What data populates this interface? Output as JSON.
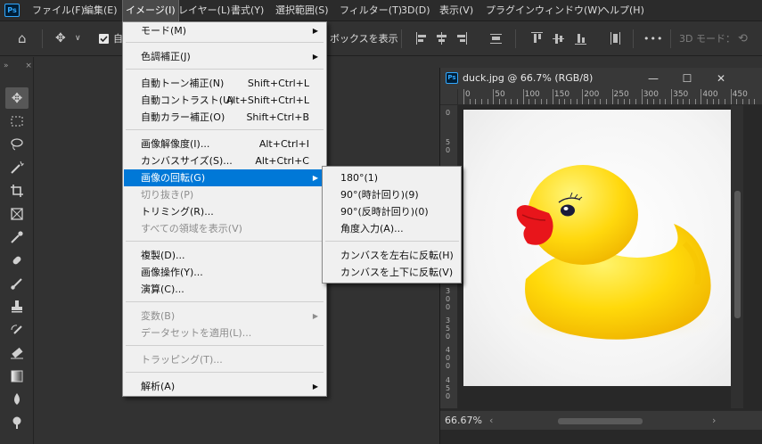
{
  "menubar": {
    "app_icon": "Ps",
    "items": [
      {
        "label": "ファイル(F)"
      },
      {
        "label": "編集(E)"
      },
      {
        "label": "イメージ(I)"
      },
      {
        "label": "レイヤー(L)"
      },
      {
        "label": "書式(Y)"
      },
      {
        "label": "選択範囲(S)"
      },
      {
        "label": "フィルター(T)"
      },
      {
        "label": "3D(D)"
      },
      {
        "label": "表示(V)"
      },
      {
        "label": "プラグイン"
      },
      {
        "label": "ウィンドウ(W)"
      },
      {
        "label": "ヘルプ(H)"
      }
    ],
    "active_index": 2
  },
  "options_bar": {
    "auto_select_label": "自",
    "show_bounding_box_label": "ボックスを表示",
    "mode_3d_label": "3D モード：",
    "more_label": "•••",
    "icons": [
      "home-icon",
      "move-tool-icon",
      "checkbox-icon",
      "align-icons",
      "more-icon",
      "3d-orbit-icon"
    ]
  },
  "tools": {
    "collapse_label": "»",
    "close_label": "×",
    "icons": [
      "move-icon",
      "marquee-icon",
      "lasso-icon",
      "magic-wand-icon",
      "crop-icon",
      "frame-icon",
      "eyedropper-icon",
      "healing-brush-icon",
      "brush-icon",
      "stamp-icon",
      "history-brush-icon",
      "eraser-icon",
      "gradient-icon",
      "blur-icon",
      "dodge-icon"
    ]
  },
  "image_menu": {
    "rows": [
      {
        "label": "モード(M)",
        "shortcut": "",
        "submenu": true,
        "disabled": false,
        "highlight": false
      },
      {
        "label": "色調補正(J)",
        "shortcut": "",
        "submenu": true,
        "disabled": false,
        "highlight": false
      },
      {
        "label": "自動トーン補正(N)",
        "shortcut": "Shift+Ctrl+L",
        "submenu": false,
        "disabled": false,
        "highlight": false
      },
      {
        "label": "自動コントラスト(U)",
        "shortcut": "Alt+Shift+Ctrl+L",
        "submenu": false,
        "disabled": false,
        "highlight": false
      },
      {
        "label": "自動カラー補正(O)",
        "shortcut": "Shift+Ctrl+B",
        "submenu": false,
        "disabled": false,
        "highlight": false
      },
      {
        "label": "画像解像度(I)...",
        "shortcut": "Alt+Ctrl+I",
        "submenu": false,
        "disabled": false,
        "highlight": false
      },
      {
        "label": "カンバスサイズ(S)...",
        "shortcut": "Alt+Ctrl+C",
        "submenu": false,
        "disabled": false,
        "highlight": false
      },
      {
        "label": "画像の回転(G)",
        "shortcut": "",
        "submenu": true,
        "disabled": false,
        "highlight": true
      },
      {
        "label": "切り抜き(P)",
        "shortcut": "",
        "submenu": false,
        "disabled": true,
        "highlight": false
      },
      {
        "label": "トリミング(R)...",
        "shortcut": "",
        "submenu": false,
        "disabled": false,
        "highlight": false
      },
      {
        "label": "すべての領域を表示(V)",
        "shortcut": "",
        "submenu": false,
        "disabled": true,
        "highlight": false
      },
      {
        "label": "複製(D)...",
        "shortcut": "",
        "submenu": false,
        "disabled": false,
        "highlight": false
      },
      {
        "label": "画像操作(Y)...",
        "shortcut": "",
        "submenu": false,
        "disabled": false,
        "highlight": false
      },
      {
        "label": "演算(C)...",
        "shortcut": "",
        "submenu": false,
        "disabled": false,
        "highlight": false
      },
      {
        "label": "変数(B)",
        "shortcut": "",
        "submenu": true,
        "disabled": true,
        "highlight": false
      },
      {
        "label": "データセットを適用(L)...",
        "shortcut": "",
        "submenu": false,
        "disabled": true,
        "highlight": false
      },
      {
        "label": "トラッピング(T)...",
        "shortcut": "",
        "submenu": false,
        "disabled": true,
        "highlight": false
      },
      {
        "label": "解析(A)",
        "shortcut": "",
        "submenu": true,
        "disabled": false,
        "highlight": false
      }
    ]
  },
  "rotate_submenu": {
    "rows": [
      {
        "label": "180°(1)"
      },
      {
        "label": "90°(時計回り)(9)"
      },
      {
        "label": "90°(反時計回り)(0)"
      },
      {
        "label": "角度入力(A)..."
      },
      {
        "label": "カンバスを左右に反転(H)"
      },
      {
        "label": "カンバスを上下に反転(V)"
      }
    ]
  },
  "document": {
    "icon_label": "Ps",
    "title": "duck.jpg @ 66.7% (RGB/8)",
    "minimize_label": "—",
    "maximize_label": "☐",
    "close_label": "✕",
    "ruler_top_labels": [
      "0",
      "50",
      "100",
      "150",
      "200",
      "250",
      "300",
      "350",
      "400",
      "450"
    ],
    "ruler_left_labels": [
      "0",
      "50",
      "100",
      "150",
      "200",
      "250",
      "300",
      "350",
      "400",
      "450"
    ],
    "zoom_status": "66.67%",
    "scroll_left": "‹",
    "scroll_right": "›"
  },
  "colors": {
    "menu_highlight": "#0078d7",
    "duck_yellow": "#ffd400",
    "beak_red": "#e8151b"
  }
}
